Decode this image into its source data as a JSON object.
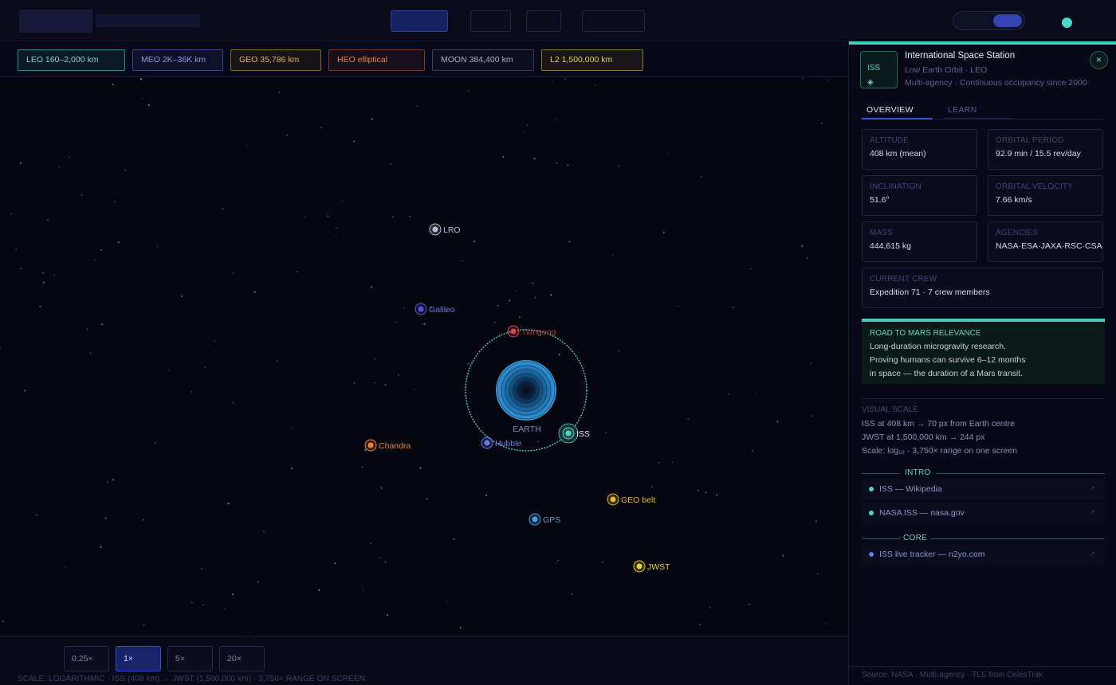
{
  "orbit_chips": [
    {
      "label": "LEO 160–2,000 km",
      "color": "#2f8f86",
      "text": "#7fd8cc"
    },
    {
      "label": "MEO 2K–36K km",
      "color": "#3b4896",
      "text": "#8c9ae6"
    },
    {
      "label": "GEO 35,786 km",
      "color": "#8a6a1f",
      "text": "#e3b04a"
    },
    {
      "label": "HEO elliptical",
      "color": "#7a3b1c",
      "text": "#e8824a"
    },
    {
      "label": "MOON 384,400 km",
      "color": "#3a3d55",
      "text": "#a8adc8"
    },
    {
      "label": "L2 1,500,000 km",
      "color": "#8a7a1c",
      "text": "#e8d045"
    }
  ],
  "map": {
    "earth_label": "EARTH",
    "objects": [
      {
        "name": "LRO",
        "color": "#b8bcd6",
        "text": "#b8bcd6"
      },
      {
        "name": "Galileo",
        "color": "#4b5bd6",
        "text": "#6a7ae0"
      },
      {
        "name": "Tiangong",
        "color": "#d04a4a",
        "text": "#b43e3e"
      },
      {
        "name": "ISS",
        "color": "#4fd6c4",
        "text": "#dfe6ff"
      },
      {
        "name": "Hubble",
        "color": "#6a7ae8",
        "text": "#6a7ae0"
      },
      {
        "name": "Chandra",
        "color": "#e8823a",
        "text": "#e8823a"
      },
      {
        "name": "GEO belt",
        "color": "#e3b832",
        "text": "#e3b832"
      },
      {
        "name": "GPS",
        "color": "#4aa0e0",
        "text": "#7090c8"
      },
      {
        "name": "JWST",
        "color": "#e8d030",
        "text": "#e8d030"
      }
    ]
  },
  "zoom": {
    "options": [
      "0.25×",
      "1×",
      "5×",
      "20×"
    ],
    "active_index": 1,
    "scale_note": "SCALE: LOGARITHMIC · ISS (408 km) → JWST (1,500,000 km) · 3,750× RANGE ON SCREEN"
  },
  "panel": {
    "badge_line1": "ISS",
    "badge_line2": "◈",
    "title": "International Space Station",
    "subtitle": "Low Earth Orbit · LEO",
    "subtitle2": "Multi-agency · Continuous occupancy since 2000",
    "close_icon": "✕",
    "tabs": [
      "OVERVIEW",
      "LEARN"
    ],
    "stats": [
      {
        "label": "ALTITUDE",
        "value": "408 km (mean)"
      },
      {
        "label": "ORBITAL PERIOD",
        "value": "92.9 min / 15.5 rev/day"
      },
      {
        "label": "INCLINATION",
        "value": "51.6°"
      },
      {
        "label": "ORBITAL VELOCITY",
        "value": "7.66 km/s"
      },
      {
        "label": "MASS",
        "value": "444,615 kg"
      },
      {
        "label": "AGENCIES",
        "value": "NASA·ESA·JAXA·RSC·CSA"
      },
      {
        "label": "CURRENT CREW",
        "value": "Expedition 71 · 7 crew members"
      }
    ],
    "mars": {
      "label": "ROAD TO MARS RELEVANCE",
      "lines": [
        "Long-duration microgravity research.",
        "Proving humans can survive 6–12 months",
        "in space — the duration of a Mars transit."
      ]
    },
    "visual_scale": {
      "label": "VISUAL SCALE",
      "lines": [
        "ISS at 408 km → 70 px from Earth centre",
        "JWST at 1,500,000 km → 244 px",
        "Scale: log₁₀ · 3,750× range on one screen"
      ]
    },
    "sections": [
      {
        "title": "INTRO",
        "links": [
          {
            "text": "ISS — Wikipedia",
            "color": "#4fd6c4"
          },
          {
            "text": "NASA ISS — nasa.gov",
            "color": "#4fd6c4"
          }
        ]
      },
      {
        "title": "CORE",
        "links": [
          {
            "text": "ISS live tracker — n2yo.com",
            "color": "#6a7ae8"
          }
        ]
      }
    ],
    "link_arrow": "↗",
    "source": "Source: NASA · Multi-agency · TLE from CelesTrak"
  }
}
